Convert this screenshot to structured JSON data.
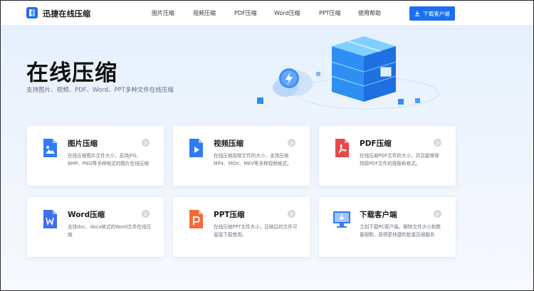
{
  "header": {
    "brand": "迅捷在线压缩",
    "nav": [
      "图片压缩",
      "视频压缩",
      "PDF压缩",
      "Word压缩",
      "PPT压缩",
      "使用帮助"
    ],
    "download_label": "下载客户端"
  },
  "hero": {
    "title": "在线压缩",
    "subtitle": "支持图片、视频、PDF、Word、PPT多种文件在线压缩"
  },
  "cards": [
    {
      "title": "图片压缩",
      "desc": "在线压缩图片文件大小，支持JPG、BMP、PNG等多种格式的图片在线压缩",
      "icon": "image-file-icon",
      "color": "#2f7cf6"
    },
    {
      "title": "视频压缩",
      "desc": "在线压缩视频文件的大小，支持压缩MP4、MOV、MKV等多种视频格式。",
      "icon": "video-file-icon",
      "color": "#2f7cf6"
    },
    {
      "title": "PDF压缩",
      "desc": "在线压缩PDF文件的大小，并且能够保持原PDF文件的排版和格式。",
      "icon": "pdf-file-icon",
      "color": "#e64a4a"
    },
    {
      "title": "Word压缩",
      "desc": "支持doc、docx格式的Word文件在线压缩",
      "icon": "word-file-icon",
      "color": "#3d6ff0"
    },
    {
      "title": "PPT压缩",
      "desc": "在线压缩PPT文件大小，压缩后的文件可直接下载使用。",
      "icon": "ppt-file-icon",
      "color": "#f26b3a"
    },
    {
      "title": "下载客户端",
      "desc": "立刻下载PC客户端，解除文件大小和数量限制，获得更快捷的批量压缩服务",
      "icon": "desktop-download-icon",
      "color": "#2f7cf6"
    }
  ]
}
